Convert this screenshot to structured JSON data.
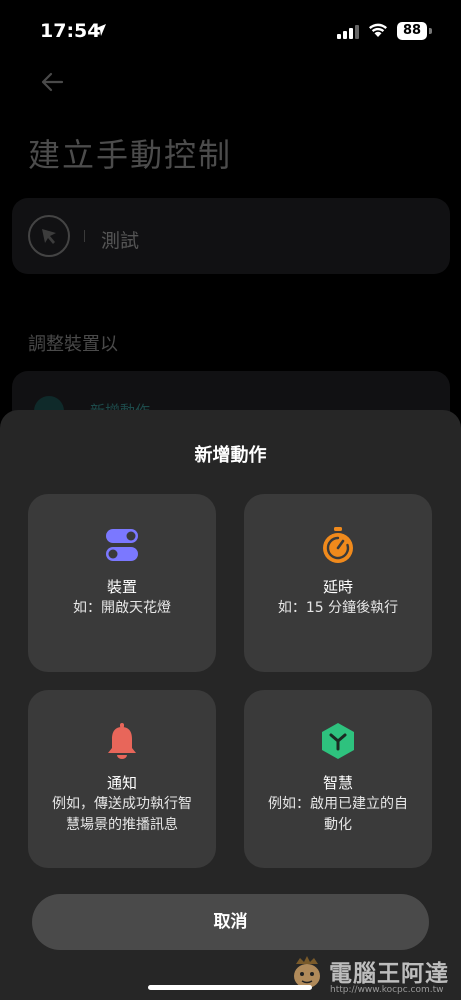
{
  "status": {
    "time": "17:54",
    "battery": "88"
  },
  "page": {
    "title": "建立手動控制"
  },
  "device_card": {
    "name": "測試"
  },
  "section": {
    "label": "調整裝置以"
  },
  "peek": {
    "label": "新增動作"
  },
  "sheet": {
    "title": "新增動作",
    "options": [
      {
        "title": "裝置",
        "desc": "如：開啟天花燈",
        "icon": "toggle-switches-icon",
        "color": "#7b78ff"
      },
      {
        "title": "延時",
        "desc": "如：15 分鐘後執行",
        "icon": "stopwatch-icon",
        "color": "#f08a1c"
      },
      {
        "title": "通知",
        "desc": "例如，傳送成功執行智慧場景的推播訊息",
        "icon": "bell-icon",
        "color": "#e8665a"
      },
      {
        "title": "智慧",
        "desc": "例如：啟用已建立的自動化",
        "icon": "hexagon-branch-icon",
        "color": "#2ec27e"
      }
    ],
    "cancel_label": "取消"
  },
  "watermark": {
    "text": "電腦王阿達",
    "url": "http://www.kocpc.com.tw"
  }
}
